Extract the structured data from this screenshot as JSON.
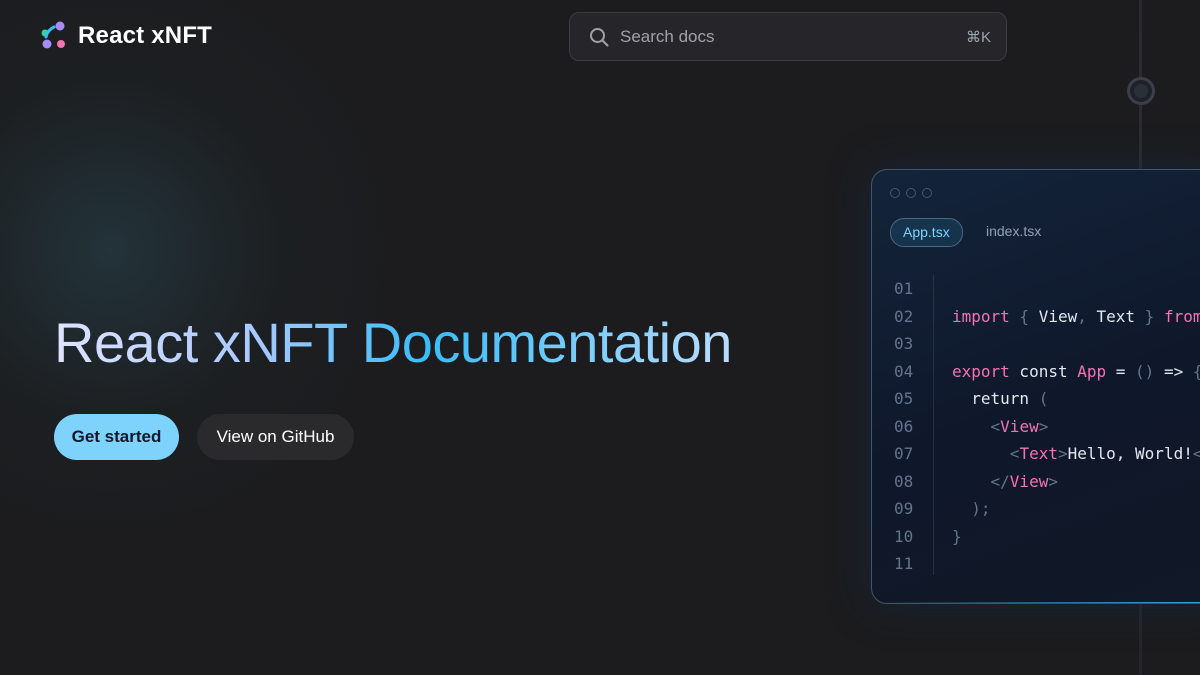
{
  "header": {
    "logo_text": "React xNFT",
    "logo_icon": "xnft-logo-icon"
  },
  "search": {
    "placeholder": "Search docs",
    "shortcut": "⌘K",
    "icon": "search-icon"
  },
  "hero": {
    "title": "React xNFT Documentation",
    "primary_button": "Get started",
    "secondary_button": "View on GitHub"
  },
  "code_window": {
    "tabs": [
      {
        "label": "App.tsx",
        "active": true
      },
      {
        "label": "index.tsx",
        "active": false
      }
    ],
    "line_numbers": [
      "01",
      "02",
      "03",
      "04",
      "05",
      "06",
      "07",
      "08",
      "09",
      "10",
      "11"
    ],
    "lines": [
      [],
      [
        [
          "kw",
          "import"
        ],
        [
          "pn",
          " { "
        ],
        [
          "tx",
          "View"
        ],
        [
          "pn",
          ", "
        ],
        [
          "tx",
          "Text"
        ],
        [
          "pn",
          " } "
        ],
        [
          "kw",
          "from"
        ]
      ],
      [],
      [
        [
          "kw",
          "export"
        ],
        [
          "tx",
          " const "
        ],
        [
          "kw",
          "App"
        ],
        [
          "tx",
          " = "
        ],
        [
          "pn",
          "()"
        ],
        [
          "tx",
          " => "
        ],
        [
          "pn",
          "{"
        ]
      ],
      [
        [
          "tx",
          "  return "
        ],
        [
          "pn",
          "("
        ]
      ],
      [
        [
          "pn",
          "    <"
        ],
        [
          "tg",
          "View"
        ],
        [
          "pn",
          ">"
        ]
      ],
      [
        [
          "pn",
          "      <"
        ],
        [
          "tg",
          "Text"
        ],
        [
          "pn",
          ">"
        ],
        [
          "tx",
          "Hello, World!"
        ],
        [
          "pn",
          "<"
        ]
      ],
      [
        [
          "pn",
          "    </"
        ],
        [
          "tg",
          "View"
        ],
        [
          "pn",
          ">"
        ]
      ],
      [
        [
          "pn",
          "  );"
        ]
      ],
      [
        [
          "pn",
          "}"
        ]
      ],
      []
    ]
  },
  "colors": {
    "background": "#1c1c1e",
    "accent": "#7dd3fc",
    "keyword": "#f472b6",
    "code_background": "#0f172a"
  }
}
